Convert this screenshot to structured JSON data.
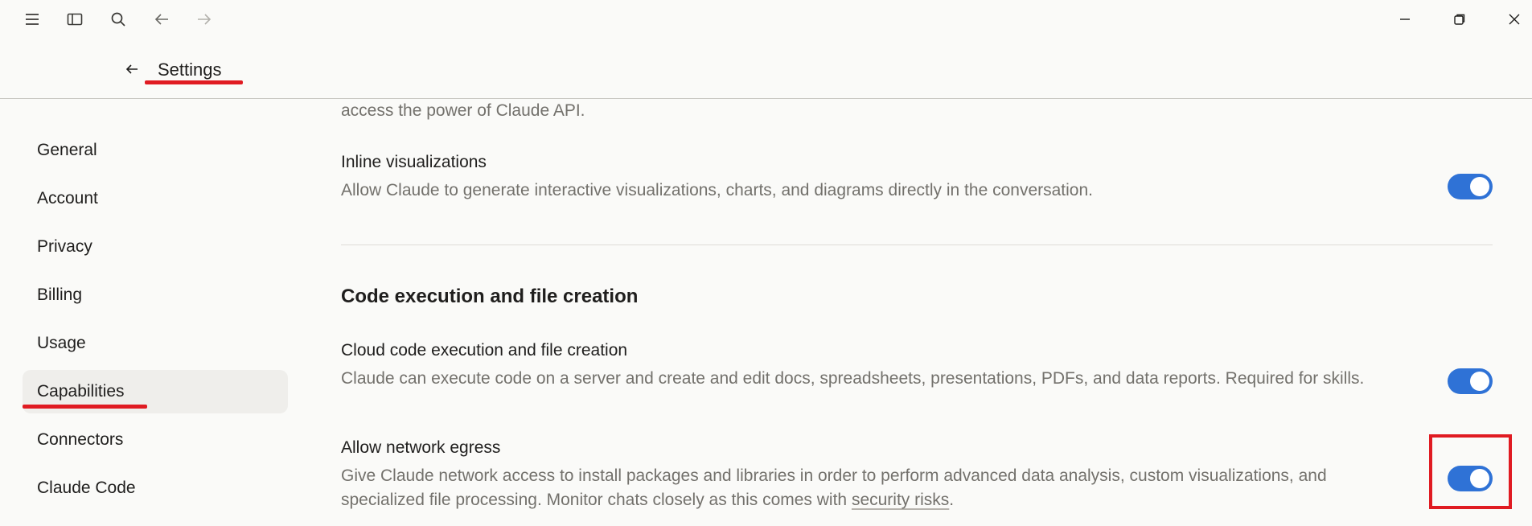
{
  "titlebar": {
    "icons": [
      "hamburger-menu-icon",
      "sidebar-toggle-icon",
      "search-icon",
      "back-arrow-icon",
      "forward-arrow-icon"
    ],
    "window_controls": [
      "minimize-icon",
      "restore-icon",
      "close-icon"
    ]
  },
  "header": {
    "back_icon": "back-arrow-icon",
    "title": "Settings"
  },
  "sidebar": {
    "items": [
      {
        "label": "General"
      },
      {
        "label": "Account"
      },
      {
        "label": "Privacy"
      },
      {
        "label": "Billing"
      },
      {
        "label": "Usage"
      },
      {
        "label": "Capabilities",
        "active": true
      },
      {
        "label": "Connectors"
      },
      {
        "label": "Claude Code"
      }
    ]
  },
  "main": {
    "cut_text": "access the power of Claude API.",
    "inline_viz": {
      "title": "Inline visualizations",
      "description": "Allow Claude to generate interactive visualizations, charts, and diagrams directly in the conversation.",
      "enabled": true
    },
    "section_heading": "Code execution and file creation",
    "cloud_code": {
      "title": "Cloud code execution and file creation",
      "description": "Claude can execute code on a server and create and edit docs, spreadsheets, presentations, PDFs, and data reports. Required for skills.",
      "enabled": true
    },
    "network_egress": {
      "title": "Allow network egress",
      "description_before": "Give Claude network access to install packages and libraries in order to perform advanced data analysis, custom visualizations, and specialized file processing. Monitor chats closely as this comes with ",
      "link_text": "security risks",
      "description_after": ".",
      "enabled": true
    }
  },
  "colors": {
    "accent_toggle": "#2f72d6",
    "annotation_red": "#e01b22",
    "active_nav_bg": "#efeeeb"
  }
}
